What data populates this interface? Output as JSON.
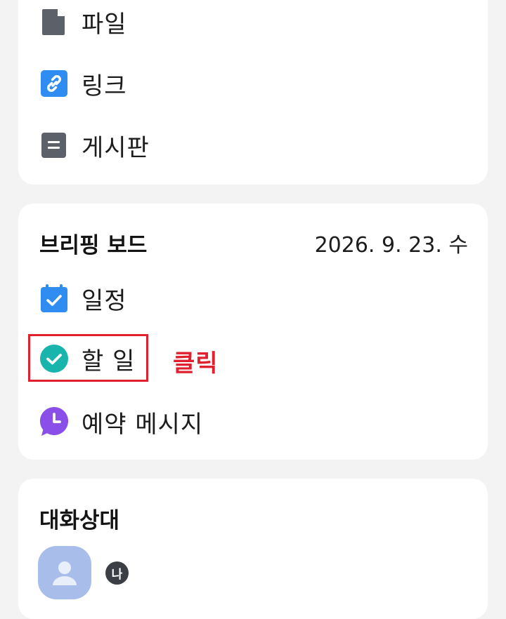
{
  "menu": {
    "items": [
      {
        "label": "파일",
        "icon": "file-icon"
      },
      {
        "label": "링크",
        "icon": "link-icon"
      },
      {
        "label": "게시판",
        "icon": "board-icon"
      }
    ]
  },
  "briefing": {
    "title": "브리핑 보드",
    "date": "2026. 9. 23. 수",
    "items": [
      {
        "label": "일정",
        "icon": "calendar-check-icon"
      },
      {
        "label": "할 일",
        "icon": "todo-check-icon"
      },
      {
        "label": "예약 메시지",
        "icon": "scheduled-message-clock-icon"
      }
    ],
    "annotation": "클릭"
  },
  "contacts": {
    "title": "대화상대",
    "me_badge": "나"
  },
  "colors": {
    "page_bg": "#f3f3f4",
    "card_bg": "#ffffff",
    "file_icon": "#5c6069",
    "link_icon": "#2f8cf0",
    "board_icon": "#5c6069",
    "calendar_icon": "#2f8cf0",
    "todo_icon": "#19b5ad",
    "message_icon": "#8a4fe8",
    "annotation_red": "#e0202e",
    "avatar_bg": "#a9bdeb"
  }
}
